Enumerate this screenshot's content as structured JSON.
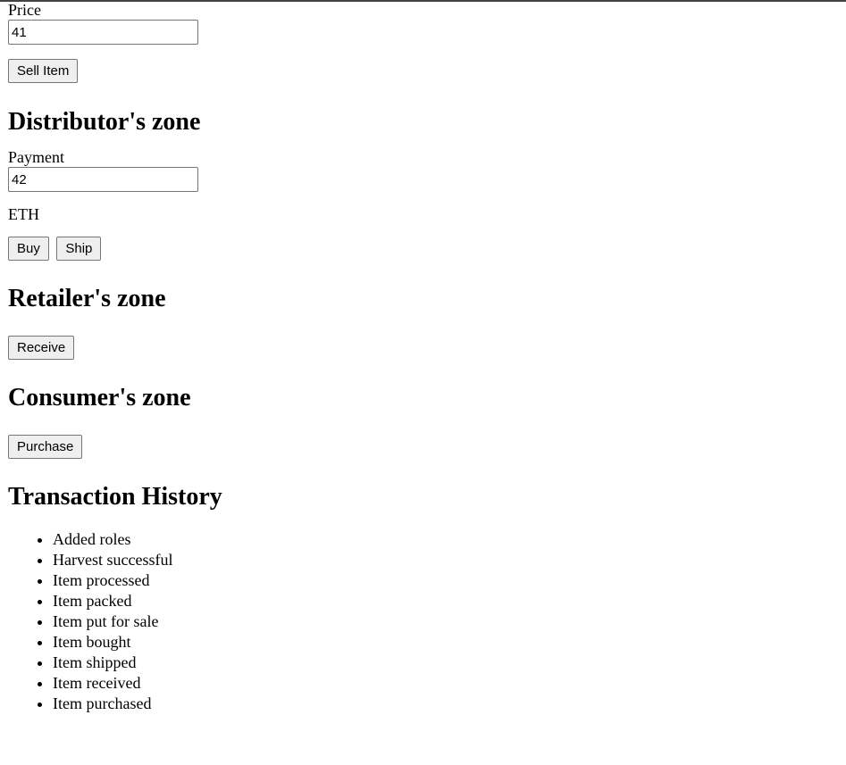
{
  "farmer_zone": {
    "price_label": "Price",
    "price_value": "41",
    "sell_button": "Sell Item"
  },
  "distributor_zone": {
    "heading": "Distributor's zone",
    "payment_label": "Payment",
    "payment_value": "42",
    "currency": "ETH",
    "buy_button": "Buy",
    "ship_button": "Ship"
  },
  "retailer_zone": {
    "heading": "Retailer's zone",
    "receive_button": "Receive"
  },
  "consumer_zone": {
    "heading": "Consumer's zone",
    "purchase_button": "Purchase"
  },
  "transaction_history": {
    "heading": "Transaction History",
    "items": [
      "Added roles",
      "Harvest successful",
      "Item processed",
      "Item packed",
      "Item put for sale",
      "Item bought",
      "Item shipped",
      "Item received",
      "Item purchased"
    ]
  }
}
